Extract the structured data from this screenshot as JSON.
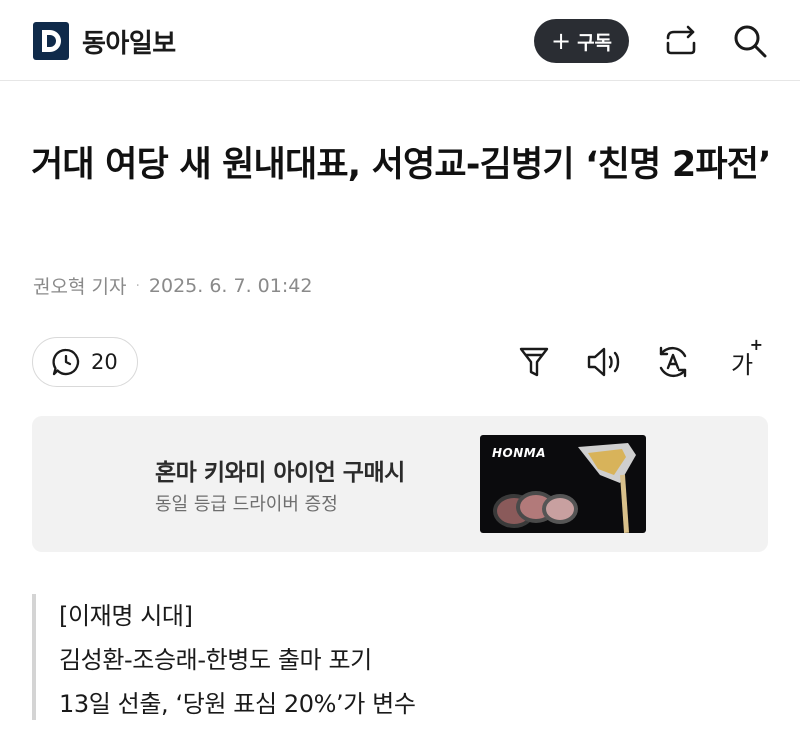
{
  "header": {
    "brand_name": "동아일보",
    "subscribe_label": "구독",
    "icons": [
      "share-icon",
      "search-icon"
    ]
  },
  "article": {
    "headline": "거대 여당 새 원내대표, 서영교-김병기 ‘친명 2파전’",
    "author": "권오혁 기자",
    "datetime": "2025. 6. 7. 01:42",
    "comment_count": "20"
  },
  "toolbar": {
    "icons": [
      "filter-icon",
      "listen-icon",
      "translate-icon",
      "font-size-icon"
    ],
    "font_size_glyph": "가",
    "font_size_plus": "+"
  },
  "ad": {
    "title": "혼마 키와미 아이언 구매시",
    "subtitle": "동일 등급 드라이버 증정",
    "image_brand": "HONMA"
  },
  "summary": {
    "lines": [
      "[이재명 시대]",
      "김성환-조승래-한병도 출마 포기",
      "13일 선출, ‘당원 표심 20%’가 변수"
    ]
  },
  "colors": {
    "brand_navy": "#0f2a4a",
    "subscribe_bg": "#2a2d33",
    "ad_bg": "#f2f2f2",
    "summary_border": "#d4d4d4",
    "byline_gray": "#8a8a8a"
  }
}
